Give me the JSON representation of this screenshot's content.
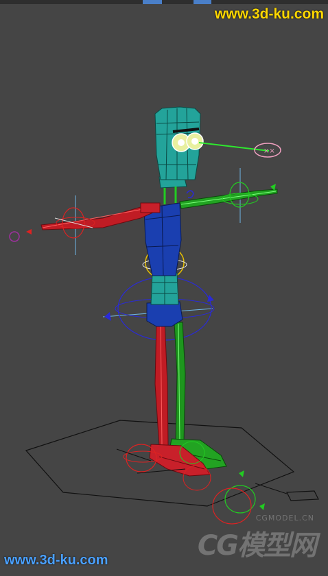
{
  "watermark_top": "www.3d-ku.com",
  "watermark_bottom": "www.3d-ku.com",
  "logo": {
    "main": "CG模型网",
    "sub": "CGMODEL.CN"
  },
  "viewport": {
    "background": "#454545",
    "content": "3D rigged cartoon character in T-pose with bones and control gizmos"
  },
  "colors": {
    "left_side": "#d4202a",
    "right_side": "#2aa52a",
    "torso": "#1a3fb0",
    "head": "#22a094",
    "accent_watermark_top": "#ffd800",
    "accent_watermark_bottom": "#4aa0ff"
  }
}
